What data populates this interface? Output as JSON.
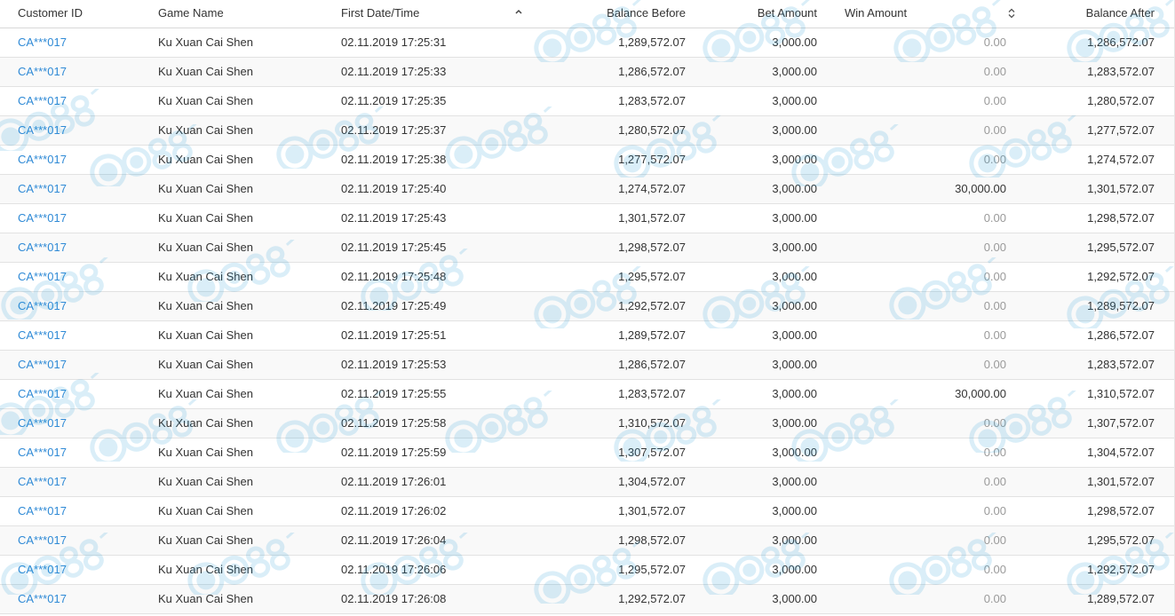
{
  "columns": {
    "customer_id": "Customer ID",
    "game_name": "Game Name",
    "first_datetime": "First Date/Time",
    "balance_before": "Balance Before",
    "bet_amount": "Bet Amount",
    "win_amount": "Win Amount",
    "balance_after": "Balance After"
  },
  "icons": {
    "sort_asc": "chevron-up-icon",
    "sort_both": "sort-icon",
    "watermark": "ca88-casino-asia-watermark"
  },
  "colors": {
    "link": "#2f8ad6",
    "zero_text": "#9a9a9a",
    "watermark": "#1e9ad6"
  },
  "rows": [
    {
      "customer": "CA***017",
      "game": "Ku Xuan Cai Shen",
      "datetime": "02.11.2019 17:25:31",
      "balance_before": "1,289,572.07",
      "bet": "3,000.00",
      "win": "0.00",
      "balance_after": "1,286,572.07"
    },
    {
      "customer": "CA***017",
      "game": "Ku Xuan Cai Shen",
      "datetime": "02.11.2019 17:25:33",
      "balance_before": "1,286,572.07",
      "bet": "3,000.00",
      "win": "0.00",
      "balance_after": "1,283,572.07"
    },
    {
      "customer": "CA***017",
      "game": "Ku Xuan Cai Shen",
      "datetime": "02.11.2019 17:25:35",
      "balance_before": "1,283,572.07",
      "bet": "3,000.00",
      "win": "0.00",
      "balance_after": "1,280,572.07"
    },
    {
      "customer": "CA***017",
      "game": "Ku Xuan Cai Shen",
      "datetime": "02.11.2019 17:25:37",
      "balance_before": "1,280,572.07",
      "bet": "3,000.00",
      "win": "0.00",
      "balance_after": "1,277,572.07"
    },
    {
      "customer": "CA***017",
      "game": "Ku Xuan Cai Shen",
      "datetime": "02.11.2019 17:25:38",
      "balance_before": "1,277,572.07",
      "bet": "3,000.00",
      "win": "0.00",
      "balance_after": "1,274,572.07"
    },
    {
      "customer": "CA***017",
      "game": "Ku Xuan Cai Shen",
      "datetime": "02.11.2019 17:25:40",
      "balance_before": "1,274,572.07",
      "bet": "3,000.00",
      "win": "30,000.00",
      "balance_after": "1,301,572.07"
    },
    {
      "customer": "CA***017",
      "game": "Ku Xuan Cai Shen",
      "datetime": "02.11.2019 17:25:43",
      "balance_before": "1,301,572.07",
      "bet": "3,000.00",
      "win": "0.00",
      "balance_after": "1,298,572.07"
    },
    {
      "customer": "CA***017",
      "game": "Ku Xuan Cai Shen",
      "datetime": "02.11.2019 17:25:45",
      "balance_before": "1,298,572.07",
      "bet": "3,000.00",
      "win": "0.00",
      "balance_after": "1,295,572.07"
    },
    {
      "customer": "CA***017",
      "game": "Ku Xuan Cai Shen",
      "datetime": "02.11.2019 17:25:48",
      "balance_before": "1,295,572.07",
      "bet": "3,000.00",
      "win": "0.00",
      "balance_after": "1,292,572.07"
    },
    {
      "customer": "CA***017",
      "game": "Ku Xuan Cai Shen",
      "datetime": "02.11.2019 17:25:49",
      "balance_before": "1,292,572.07",
      "bet": "3,000.00",
      "win": "0.00",
      "balance_after": "1,289,572.07"
    },
    {
      "customer": "CA***017",
      "game": "Ku Xuan Cai Shen",
      "datetime": "02.11.2019 17:25:51",
      "balance_before": "1,289,572.07",
      "bet": "3,000.00",
      "win": "0.00",
      "balance_after": "1,286,572.07"
    },
    {
      "customer": "CA***017",
      "game": "Ku Xuan Cai Shen",
      "datetime": "02.11.2019 17:25:53",
      "balance_before": "1,286,572.07",
      "bet": "3,000.00",
      "win": "0.00",
      "balance_after": "1,283,572.07"
    },
    {
      "customer": "CA***017",
      "game": "Ku Xuan Cai Shen",
      "datetime": "02.11.2019 17:25:55",
      "balance_before": "1,283,572.07",
      "bet": "3,000.00",
      "win": "30,000.00",
      "balance_after": "1,310,572.07"
    },
    {
      "customer": "CA***017",
      "game": "Ku Xuan Cai Shen",
      "datetime": "02.11.2019 17:25:58",
      "balance_before": "1,310,572.07",
      "bet": "3,000.00",
      "win": "0.00",
      "balance_after": "1,307,572.07"
    },
    {
      "customer": "CA***017",
      "game": "Ku Xuan Cai Shen",
      "datetime": "02.11.2019 17:25:59",
      "balance_before": "1,307,572.07",
      "bet": "3,000.00",
      "win": "0.00",
      "balance_after": "1,304,572.07"
    },
    {
      "customer": "CA***017",
      "game": "Ku Xuan Cai Shen",
      "datetime": "02.11.2019 17:26:01",
      "balance_before": "1,304,572.07",
      "bet": "3,000.00",
      "win": "0.00",
      "balance_after": "1,301,572.07"
    },
    {
      "customer": "CA***017",
      "game": "Ku Xuan Cai Shen",
      "datetime": "02.11.2019 17:26:02",
      "balance_before": "1,301,572.07",
      "bet": "3,000.00",
      "win": "0.00",
      "balance_after": "1,298,572.07"
    },
    {
      "customer": "CA***017",
      "game": "Ku Xuan Cai Shen",
      "datetime": "02.11.2019 17:26:04",
      "balance_before": "1,298,572.07",
      "bet": "3,000.00",
      "win": "0.00",
      "balance_after": "1,295,572.07"
    },
    {
      "customer": "CA***017",
      "game": "Ku Xuan Cai Shen",
      "datetime": "02.11.2019 17:26:06",
      "balance_before": "1,295,572.07",
      "bet": "3,000.00",
      "win": "0.00",
      "balance_after": "1,292,572.07"
    },
    {
      "customer": "CA***017",
      "game": "Ku Xuan Cai Shen",
      "datetime": "02.11.2019 17:26:08",
      "balance_before": "1,292,572.07",
      "bet": "3,000.00",
      "win": "0.00",
      "balance_after": "1,289,572.07"
    }
  ]
}
